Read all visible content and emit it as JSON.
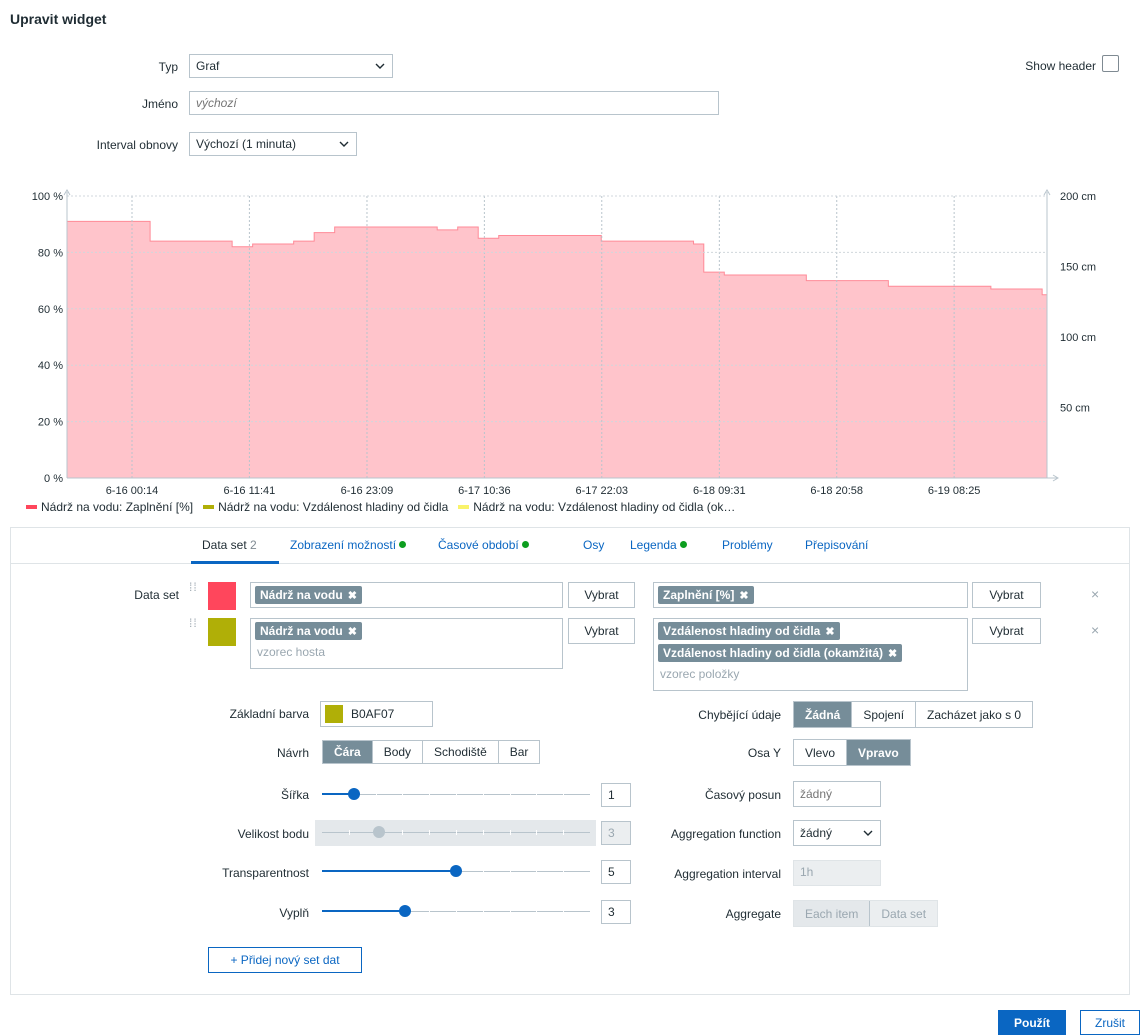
{
  "dialog": {
    "title": "Upravit widget"
  },
  "form": {
    "type_label": "Typ",
    "type_value": "Graf",
    "name_label": "Jméno",
    "name_placeholder": "výchozí",
    "refresh_label": "Interval obnovy",
    "refresh_value": "Výchozí (1 minuta)",
    "show_header_label": "Show header"
  },
  "chart_data": {
    "type": "area",
    "x_ticks": [
      "6-16 00:14",
      "6-16 11:41",
      "6-16 23:09",
      "6-17 10:36",
      "6-17 22:03",
      "6-18 09:31",
      "6-18 20:58",
      "6-19 08:25"
    ],
    "y_left_ticks": [
      "0 %",
      "20 %",
      "40 %",
      "60 %",
      "80 %",
      "100 %"
    ],
    "y_right_ticks": [
      "50 cm",
      "100 cm",
      "150 cm",
      "200 cm"
    ],
    "ylim_left": [
      0,
      100
    ],
    "ylim_right": [
      0,
      200
    ],
    "grid": true,
    "series": [
      {
        "name": "Nádrž na vodu: Zaplnění [%]",
        "color": "#FF465C",
        "x": [
          "6-15 23:30",
          "6-16 01:00",
          "6-16 02:00",
          "6-16 04:00",
          "6-16 06:00",
          "6-16 08:30",
          "6-16 10:00",
          "6-16 12:00",
          "6-16 14:00",
          "6-16 16:00",
          "6-16 18:00",
          "6-16 20:00",
          "6-16 22:00",
          "6-17 02:00",
          "6-17 06:00",
          "6-17 08:00",
          "6-17 09:00",
          "6-17 10:00",
          "6-17 12:00",
          "6-17 14:00",
          "6-17 18:00",
          "6-17 22:00",
          "6-18 02:00",
          "6-18 06:00",
          "6-18 07:00",
          "6-18 08:00",
          "6-18 10:00",
          "6-18 14:00",
          "6-18 18:00",
          "6-18 22:00",
          "6-19 02:00",
          "6-19 06:00",
          "6-19 08:00",
          "6-19 12:00",
          "6-19 14:00",
          "6-19 16:00",
          "6-19 17:00"
        ],
        "y": [
          91,
          91,
          84,
          84,
          84,
          84,
          82,
          83,
          83,
          84,
          87,
          89,
          89,
          89,
          88,
          89,
          89,
          85,
          86,
          86,
          86,
          84,
          84,
          84,
          83,
          73,
          72,
          72,
          70,
          70,
          68,
          68,
          68,
          67,
          67,
          67,
          65
        ]
      },
      {
        "name": "Nádrž na vodu: Vzdálenost hladiny od čidla",
        "color": "#B0AF07"
      },
      {
        "name": "Nádrž na vodu: Vzdálenost hladiny od čidla (ok…",
        "color": "#F9F36A"
      }
    ]
  },
  "tabs": [
    {
      "label": "Data set",
      "count": "2"
    },
    {
      "label": "Zobrazení možností"
    },
    {
      "label": "Časové období"
    },
    {
      "label": "Osy"
    },
    {
      "label": "Legenda"
    },
    {
      "label": "Problémy"
    },
    {
      "label": "Přepisování"
    }
  ],
  "dataset": {
    "label": "Data set",
    "rows": [
      {
        "color": "#FF465C",
        "host_chip": "Nádrž na vodu",
        "item_chips": [
          "Zaplnění [%]"
        ]
      },
      {
        "color": "#B0AF07",
        "host_chip": "Nádrž na vodu",
        "host_placeholder": "vzorec hosta",
        "item_chips": [
          "Vzdálenost hladiny od čidla",
          "Vzdálenost hladiny od čidla (okamžitá)"
        ],
        "item_placeholder": "vzorec položky"
      }
    ],
    "select_button": "Vybrat",
    "remove_icon": "×",
    "chip_close": "✖"
  },
  "options": {
    "base_color_label": "Základní barva",
    "base_color_value": "B0AF07",
    "base_color": "#B0AF07",
    "design_label": "Návrh",
    "design_opts": [
      "Čára",
      "Body",
      "Schodiště",
      "Bar"
    ],
    "width_label": "Šířka",
    "width_value": "1",
    "width_level": 0.1,
    "point_size_label": "Velikost bodu",
    "point_size_value": "3",
    "point_size_level": 0.2,
    "transparency_label": "Transparentnost",
    "transparency_value": "5",
    "transparency_level": 0.5,
    "fill_label": "Vyplň",
    "fill_value": "3",
    "fill_level": 0.3,
    "missing_label": "Chybějící údaje",
    "missing_opts": [
      "Žádná",
      "Spojení",
      "Zacházet jako s 0"
    ],
    "y_axis_label": "Osa Y",
    "y_axis_opts": [
      "Vlevo",
      "Vpravo"
    ],
    "time_shift_label": "Časový posun",
    "time_shift_placeholder": "žádný",
    "agg_fn_label": "Aggregation function",
    "agg_fn_value": "žádný",
    "agg_interval_label": "Aggregation interval",
    "agg_interval_value": "1h",
    "aggregate_label": "Aggregate",
    "aggregate_opts": [
      "Each item",
      "Data set"
    ]
  },
  "add_dataset_button": "+ Přidej nový set dat",
  "footer": {
    "apply": "Použít",
    "cancel": "Zrušit"
  }
}
